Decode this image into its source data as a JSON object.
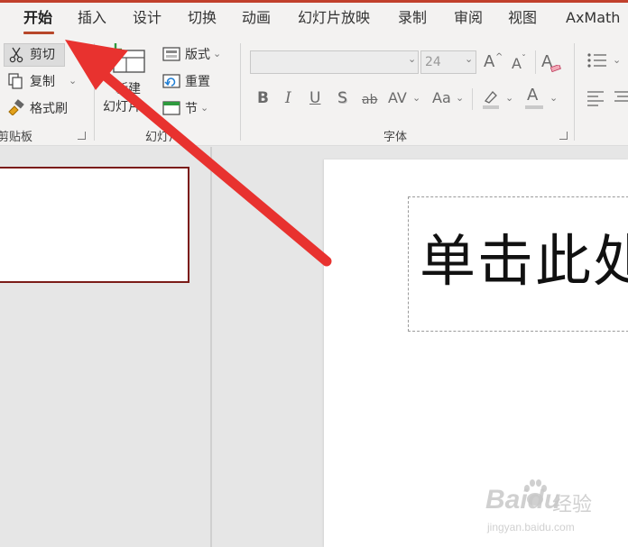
{
  "tabs": [
    "开始",
    "插入",
    "设计",
    "切换",
    "动画",
    "幻灯片放映",
    "录制",
    "审阅",
    "视图",
    "AxMath"
  ],
  "clipboard": {
    "cut": "剪切",
    "copy": "复制",
    "format_painter": "格式刷",
    "group_label": "剪贴板"
  },
  "slides": {
    "new_slide_line1": "新建",
    "new_slide_line2": "幻灯片",
    "layout": "版式",
    "reset": "重置",
    "section": "节",
    "group_label": "幻灯片"
  },
  "font": {
    "name_value": "",
    "size_value": "24",
    "grow": "A",
    "shrink": "A",
    "clear": "A",
    "bold": "B",
    "italic": "I",
    "underline": "U",
    "shadow": "S",
    "strike": "ab",
    "spacing": "AV",
    "case": "Aa",
    "font_color": "A",
    "group_label": "字体"
  },
  "canvas": {
    "title_placeholder": "单击此处"
  },
  "watermark": {
    "brand": "Baidu",
    "brand_cn": "经验",
    "url": "jingyan.baidu.com"
  },
  "colors": {
    "accent": "#b7472a",
    "thumb_border": "#7b1c18",
    "arrow": "#e8322f"
  }
}
